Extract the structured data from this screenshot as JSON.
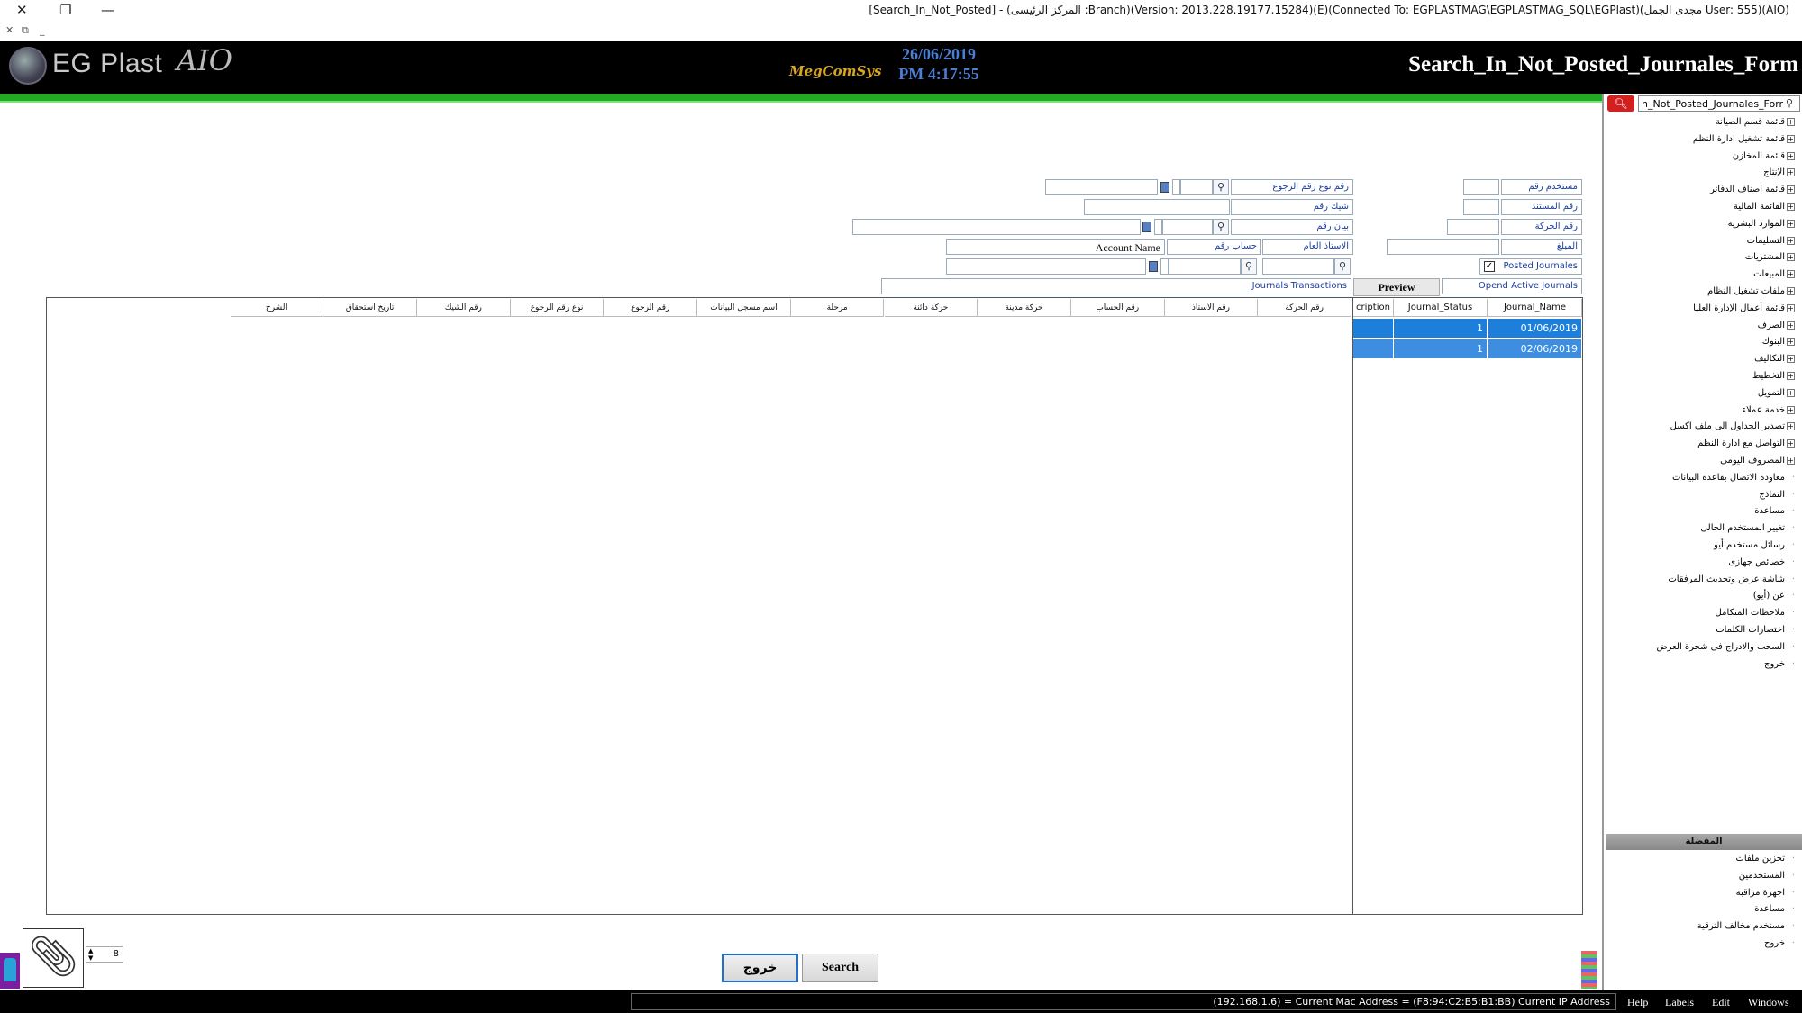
{
  "window": {
    "title": "[Search_In_Not_Posted] - (المركز الرئيسى :Branch)(Version: 2013.228.19177.15284)(E)(Connected To: EGPLASTMAG\\EGPLASTMAG_SQL\\EGPlast)(مجدى الجمل User: 555)(AIO)"
  },
  "header": {
    "logo_text": "EG Plast",
    "logo_suffix": "AIO",
    "brand": "MegComSys",
    "date": "26/06/2019",
    "time": "PM 4:17:55",
    "form_title": "Search_In_Not_Posted_Journales_Form"
  },
  "sidebar": {
    "search_value": "n_Not_Posted_Journales_Form",
    "items": [
      {
        "label": "قائمة قسم الصيانة",
        "expandable": true
      },
      {
        "label": "قائمة تشغيل ادارة النظم",
        "expandable": true
      },
      {
        "label": "قائمة المخازن",
        "expandable": true
      },
      {
        "label": "الإنتاج",
        "expandable": true
      },
      {
        "label": "قائمة اصناف الدفاتر",
        "expandable": true
      },
      {
        "label": "القائمة المالية",
        "expandable": true
      },
      {
        "label": "الموارد البشرية",
        "expandable": true
      },
      {
        "label": "التسليمات",
        "expandable": true
      },
      {
        "label": "المشتريات",
        "expandable": true
      },
      {
        "label": "المبيعات",
        "expandable": true
      },
      {
        "label": "ملفات تشغيل النظام",
        "expandable": true
      },
      {
        "label": "قائمة أعمال الإدارة العليا",
        "expandable": true
      },
      {
        "label": "الصرف",
        "expandable": true
      },
      {
        "label": "البنوك",
        "expandable": true
      },
      {
        "label": "التكاليف",
        "expandable": true
      },
      {
        "label": "التخطيط",
        "expandable": true
      },
      {
        "label": "التمويل",
        "expandable": true
      },
      {
        "label": "خدمة عملاء",
        "expandable": true
      },
      {
        "label": "تصدير الجداول الى ملف اكسل",
        "expandable": true
      },
      {
        "label": "التواصل مع ادارة النظم",
        "expandable": true
      },
      {
        "label": "المصروف اليومى",
        "expandable": true
      },
      {
        "label": "معاودة الاتصال بقاعدة البيانات",
        "expandable": false
      },
      {
        "label": "النماذج",
        "expandable": false
      },
      {
        "label": "مساعدة",
        "expandable": false
      },
      {
        "label": "تغيير المستخدم الحالى",
        "expandable": false
      },
      {
        "label": "رسائل مستخدم أيو",
        "expandable": false
      },
      {
        "label": "خصائص جهازى",
        "expandable": false
      },
      {
        "label": "شاشة عرض وتحديث المرفقات",
        "expandable": false
      },
      {
        "label": "عن (أيو)",
        "expandable": false
      },
      {
        "label": "ملاحظات المتكامل",
        "expandable": false
      },
      {
        "label": "اختصارات الكلمات",
        "expandable": false
      },
      {
        "label": "السحب والادراج فى شجرة العرض",
        "expandable": false
      },
      {
        "label": "خروج",
        "expandable": false
      }
    ],
    "favorites_title": "المفضلة",
    "favorites": [
      "تخزين ملفات",
      "المستخدمين",
      "اجهزة مراقبة",
      "مساعدة",
      "مستخدم مخالف الترقية",
      "خروج"
    ]
  },
  "form": {
    "labels": {
      "user_no": "مستخدم رقم",
      "doc_no": "رقم المستند",
      "move_no": "رقم الحركة",
      "amount": "المبلغ",
      "posted_journals": "Posted Journales",
      "open_active": "Opend Active Journals",
      "return_type": "رقم نوع رقم الرجوع",
      "check_no": "شيك رقم",
      "statement_no": "بيان رقم",
      "general_ledger": "الاستاذ العام",
      "account_no": "حساب رقم",
      "account_name": "Account Name",
      "journals_transactions": "Journals Transactions"
    },
    "posted_checked": true,
    "preview_label": "Preview"
  },
  "journals_grid": {
    "columns": [
      "Journal_Name",
      "Journal_Status",
      "cription"
    ],
    "rows": [
      {
        "name": "01/06/2019",
        "status": "1",
        "desc": ""
      },
      {
        "name": "02/06/2019",
        "status": "1",
        "desc": ""
      }
    ]
  },
  "transactions_grid": {
    "columns": [
      "رقم الحركة",
      "رقم الاستاذ",
      "رقم الحساب",
      "حركة مدينة",
      "حركة دائنة",
      "مرحلة",
      "اسم مسجل البيانات",
      "رقم الرجوع",
      "نوع رقم الرجوع",
      "رقم الشيك",
      "تاريخ استحقاق",
      "الشرح"
    ]
  },
  "buttons": {
    "exit": "خروج",
    "search": "Search"
  },
  "stepper_value": "8",
  "status": {
    "text": "(192.168.1.6) = Current Mac Address = (F8:94:C2:B5:B1:BB) Current IP Address",
    "menu": [
      "Help",
      "Labels",
      "Edit",
      "Windows"
    ]
  }
}
